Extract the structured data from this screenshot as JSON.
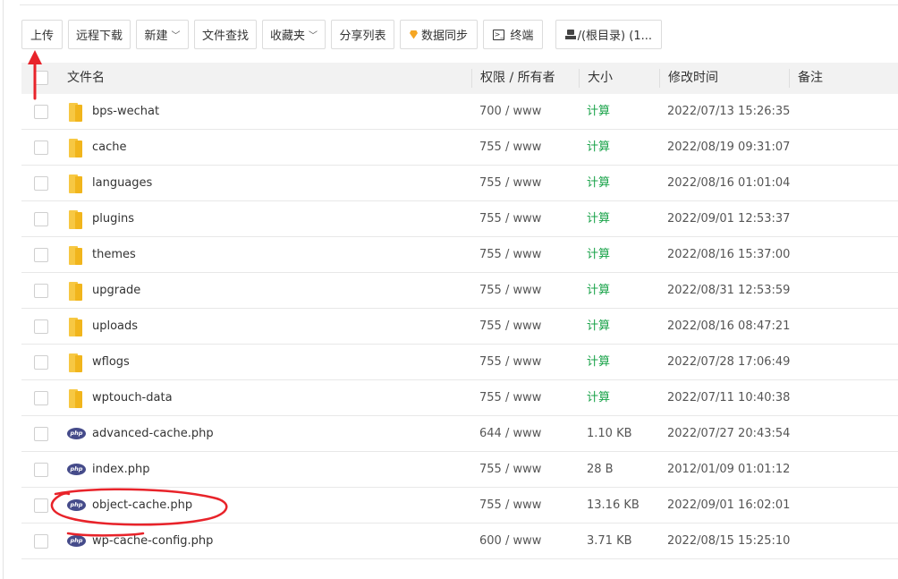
{
  "toolbar": {
    "buttons": [
      {
        "label": "上传"
      },
      {
        "label": "远程下载"
      },
      {
        "label": "新建",
        "caret": "﹀"
      },
      {
        "label": "文件查找"
      },
      {
        "label": "收藏夹",
        "caret": "﹀"
      },
      {
        "label": "分享列表"
      },
      {
        "label": "数据同步",
        "icon": "diamond-icon"
      },
      {
        "label": "终端",
        "icon": "terminal-icon"
      },
      {
        "label": "/(根目录) (1...",
        "icon": "drive-icon"
      }
    ]
  },
  "table": {
    "headers": {
      "name": "文件名",
      "perm": "权限 / 所有者",
      "size": "大小",
      "mtime": "修改时间",
      "note": "备注"
    },
    "rows": [
      {
        "type": "folder",
        "name": "bps-wechat",
        "perm": "700 / www",
        "size": "计算",
        "mtime": "2022/07/13 15:26:35"
      },
      {
        "type": "folder",
        "name": "cache",
        "perm": "755 / www",
        "size": "计算",
        "mtime": "2022/08/19 09:31:07"
      },
      {
        "type": "folder",
        "name": "languages",
        "perm": "755 / www",
        "size": "计算",
        "mtime": "2022/08/16 01:01:04"
      },
      {
        "type": "folder",
        "name": "plugins",
        "perm": "755 / www",
        "size": "计算",
        "mtime": "2022/09/01 12:53:37"
      },
      {
        "type": "folder",
        "name": "themes",
        "perm": "755 / www",
        "size": "计算",
        "mtime": "2022/08/16 15:37:00"
      },
      {
        "type": "folder",
        "name": "upgrade",
        "perm": "755 / www",
        "size": "计算",
        "mtime": "2022/08/31 12:53:59"
      },
      {
        "type": "folder",
        "name": "uploads",
        "perm": "755 / www",
        "size": "计算",
        "mtime": "2022/08/16 08:47:21"
      },
      {
        "type": "folder",
        "name": "wflogs",
        "perm": "755 / www",
        "size": "计算",
        "mtime": "2022/07/28 17:06:49"
      },
      {
        "type": "folder",
        "name": "wptouch-data",
        "perm": "755 / www",
        "size": "计算",
        "mtime": "2022/07/11 10:40:38"
      },
      {
        "type": "php",
        "name": "advanced-cache.php",
        "perm": "644 / www",
        "size": "1.10 KB",
        "mtime": "2022/07/27 20:43:54"
      },
      {
        "type": "php",
        "name": "index.php",
        "perm": "755 / www",
        "size": "28 B",
        "mtime": "2012/01/09 01:01:12"
      },
      {
        "type": "php",
        "name": "object-cache.php",
        "perm": "755 / www",
        "size": "13.16 KB",
        "mtime": "2022/09/01 16:02:01"
      },
      {
        "type": "php",
        "name": "wp-cache-config.php",
        "perm": "600 / www",
        "size": "3.71 KB",
        "mtime": "2022/08/15 15:25:10"
      }
    ]
  },
  "php_icon_text": "php",
  "colors": {
    "calc_link": "#1aa34a",
    "folder": "#f7c843",
    "php_badge": "#454b8a",
    "annotation_red": "#e8232a",
    "header_bg": "#f2f2f2"
  }
}
